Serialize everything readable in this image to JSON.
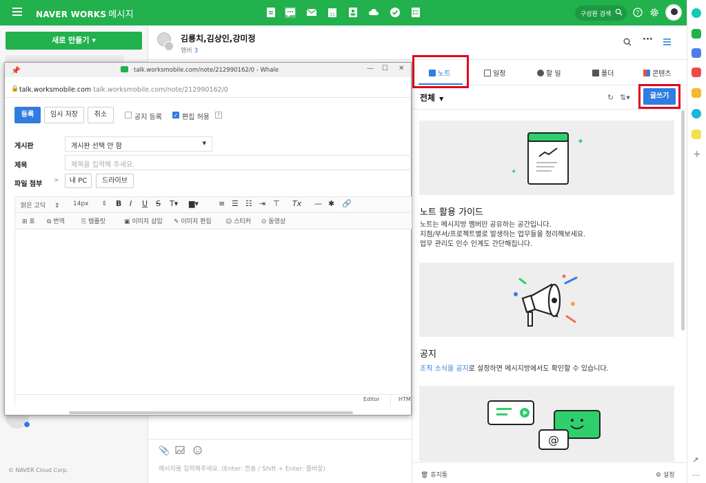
{
  "topbar": {
    "brand": "NAVER WORKS",
    "brand_sub": "메시지",
    "search_placeholder": "구성원 검색"
  },
  "sidebar": {
    "new_button": "새로 만들기 ▾",
    "copyright": "© NAVER Cloud Corp."
  },
  "chat": {
    "title": "김룡치,김상인,강미정",
    "members_label": "멤버",
    "members_count": "3",
    "input_placeholder": "메시지를 입력해주세요. (Enter: 전송 / Shift + Enter: 줄바꿈)"
  },
  "popup": {
    "window_title": "talk.worksmobile.com/note/212990162/0 - Whale",
    "url_host": "talk.worksmobile.com",
    "url_path": "talk.worksmobile.com/note/212990162/0",
    "btn_register": "등록",
    "btn_temp_save": "임시 저장",
    "btn_cancel": "취소",
    "chk_notice": "공지 등록",
    "chk_edit": "편집 허용",
    "help": "?",
    "label_board": "게시판",
    "board_value": "게시판 선택 안 함",
    "label_title": "제목",
    "title_placeholder": "제목을 입력해 주세요.",
    "label_attach": "파일 첨부",
    "attach_arrow": ">",
    "btn_my_pc": "내 PC",
    "btn_drive": "드라이브",
    "font_name": "맑은 고딕",
    "font_size": "14px",
    "tb_table": "표",
    "tb_translate": "번역",
    "tb_template": "템플릿",
    "tb_image_insert": "이미지 삽입",
    "tb_image_edit": "이미지 편집",
    "tb_sticker": "스티커",
    "tb_video": "동영상",
    "tab_editor": "Editor",
    "tab_html": "HTML"
  },
  "right_panel": {
    "tabs": [
      {
        "label": "노트",
        "icon": "note-icon",
        "color": "#2f7de1"
      },
      {
        "label": "일정",
        "icon": "calendar-icon",
        "color": "#555555"
      },
      {
        "label": "할 일",
        "icon": "check-icon",
        "color": "#555555"
      },
      {
        "label": "폴더",
        "icon": "folder-icon",
        "color": "#555555"
      },
      {
        "label": "콘텐츠",
        "icon": "contents-icon",
        "color": "#e94f3c"
      }
    ],
    "filter": "전체",
    "write_button": "글쓰기",
    "guide_title": "노트 활용 가이드",
    "guide_lines": [
      "노트는 메시지방 멤버만 공유하는 공간입니다.",
      "지점/부서/프로젝트별로 발생하는 업무들을 정리해보세요.",
      "업무 관리도 인수 인계도 간단해집니다."
    ],
    "notice_title": "공지",
    "notice_link": "조직 소식을 공지",
    "notice_rest": "로 설정하면 메시지방에서도 확인할 수 있습니다.",
    "trash": "휴지통",
    "settings": "설정"
  },
  "colors": {
    "brand_green": "#22b14c",
    "accent_blue": "#2f7de1",
    "highlight_red": "#e0001b"
  }
}
